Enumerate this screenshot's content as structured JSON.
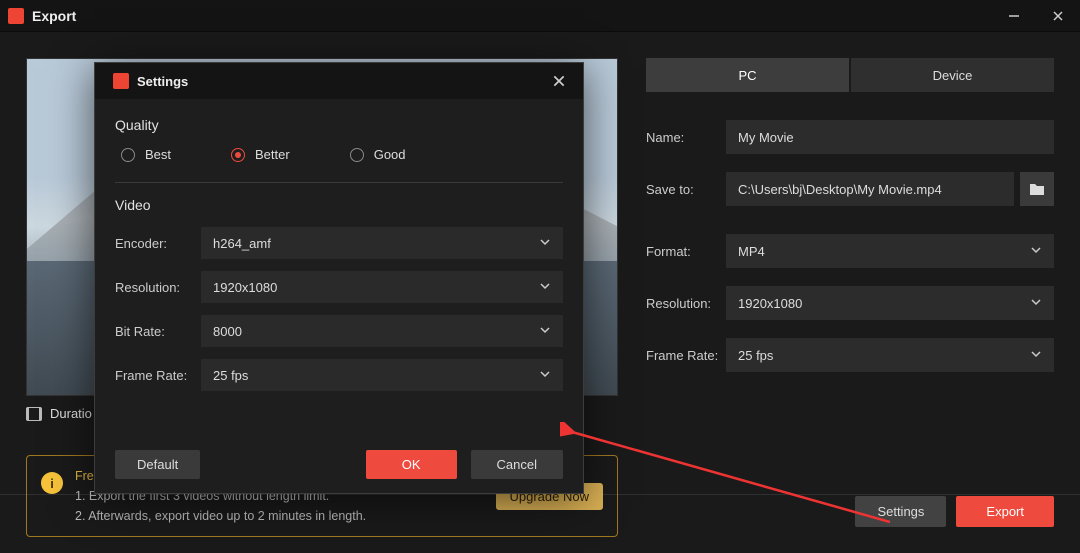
{
  "titlebar": {
    "title": "Export"
  },
  "preview": {
    "duration_label": "Duratio"
  },
  "export_panel": {
    "tabs": {
      "pc": "PC",
      "device": "Device"
    },
    "name_label": "Name:",
    "name_value": "My Movie",
    "save_label": "Save to:",
    "save_value": "C:\\Users\\bj\\Desktop\\My Movie.mp4",
    "format_label": "Format:",
    "format_value": "MP4",
    "resolution_label": "Resolution:",
    "resolution_value": "1920x1080",
    "framerate_label": "Frame Rate:",
    "framerate_value": "25 fps"
  },
  "limitations": {
    "title": "Free Edition Limitations:",
    "line1": "1. Export the first 3 videos without length limit.",
    "line2": "2. Afterwards, export video up to 2 minutes in length.",
    "upgrade": "Upgrade Now"
  },
  "buttons": {
    "settings": "Settings",
    "export": "Export"
  },
  "modal": {
    "title": "Settings",
    "quality_title": "Quality",
    "radios": {
      "best": "Best",
      "better": "Better",
      "good": "Good",
      "selected": "better"
    },
    "video_title": "Video",
    "encoder_label": "Encoder:",
    "encoder_value": "h264_amf",
    "resolution_label": "Resolution:",
    "resolution_value": "1920x1080",
    "bitrate_label": "Bit Rate:",
    "bitrate_value": "8000",
    "framerate_label": "Frame Rate:",
    "framerate_value": "25 fps",
    "default_btn": "Default",
    "ok_btn": "OK",
    "cancel_btn": "Cancel"
  }
}
